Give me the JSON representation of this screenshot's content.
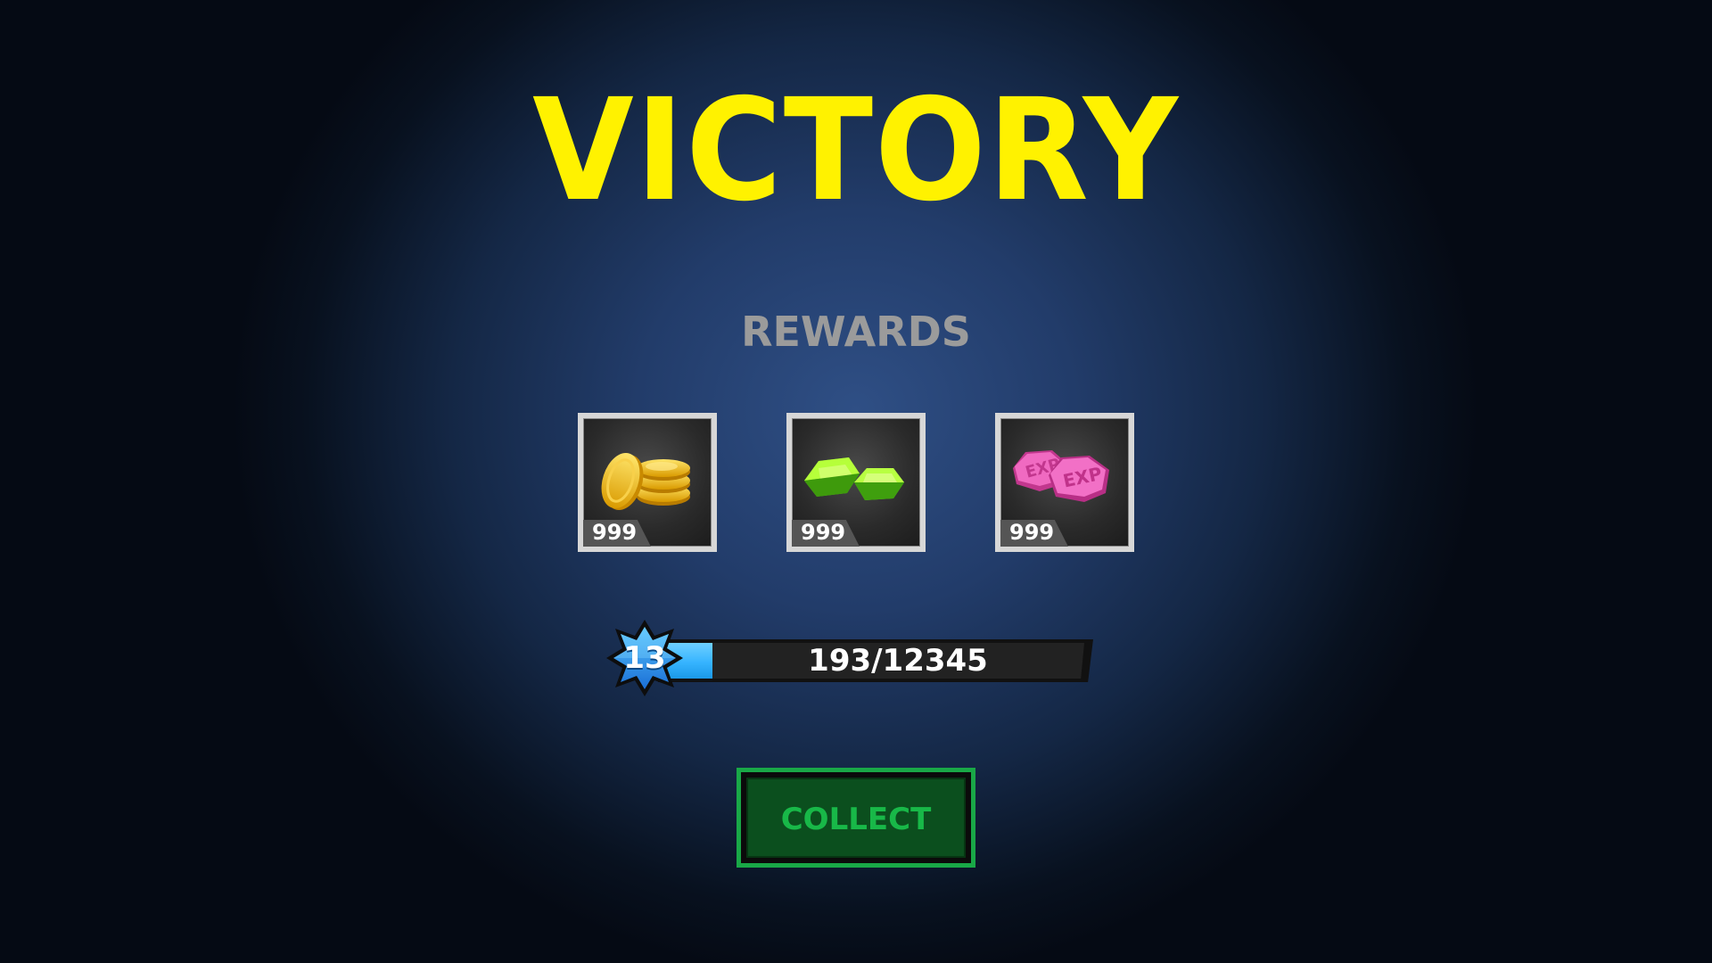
{
  "screen": {
    "title": "VICTORY",
    "rewards_label": "REWARDS"
  },
  "rewards": [
    {
      "type": "gold-coins",
      "icon": "gold-coins-icon",
      "quantity": "999"
    },
    {
      "type": "green-gems",
      "icon": "green-gems-icon",
      "quantity": "999"
    },
    {
      "type": "exp-stones",
      "icon": "exp-stones-icon",
      "quantity": "999"
    }
  ],
  "progress": {
    "level": "13",
    "xp_text": "193/12345",
    "fill_fraction": 0.12
  },
  "actions": {
    "collect_label": "COLLECT"
  },
  "colors": {
    "title": "#fff200",
    "rewards_label": "#9b9b9b",
    "xp_fill": "#36b4ff",
    "collect_border": "#19a847",
    "collect_text": "#18b848"
  },
  "exp_stamp": "EXP"
}
